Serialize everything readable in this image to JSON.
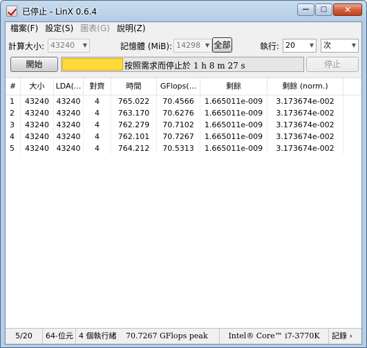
{
  "window": {
    "title": "已停止 - LinX 0.6.4",
    "minimize_glyph": "—",
    "maximize_glyph": "□",
    "close_glyph": "✕"
  },
  "menu": [
    {
      "label": "檔案(F)",
      "enabled": true
    },
    {
      "label": "設定(S)",
      "enabled": true
    },
    {
      "label": "圖表(G)",
      "enabled": false
    },
    {
      "label": "說明(Z)",
      "enabled": true
    }
  ],
  "controls": {
    "problem_size_label": "計算大小:",
    "problem_size_value": "43240",
    "memory_label": "記憶體 (MiB):",
    "memory_value": "14298",
    "all_button": "全部",
    "run_label": "執行:",
    "run_count": "20",
    "run_unit": "次",
    "start_button": "開始",
    "stop_button": "停止",
    "progress_text": "按照需求而停止於 1 h 8 m 27 s",
    "progress_fraction": 0.25
  },
  "table": {
    "columns": [
      "#",
      "大小",
      "LDA(...",
      "對齊",
      "時間",
      "GFlops(...",
      "剩餘",
      "剩餘 (norm.)"
    ],
    "rows": [
      [
        "1",
        "43240",
        "43240",
        "4",
        "765.022",
        "70.4566",
        "1.665011e-009",
        "3.173674e-002"
      ],
      [
        "2",
        "43240",
        "43240",
        "4",
        "763.170",
        "70.6276",
        "1.665011e-009",
        "3.173674e-002"
      ],
      [
        "3",
        "43240",
        "43240",
        "4",
        "762.279",
        "70.7102",
        "1.665011e-009",
        "3.173674e-002"
      ],
      [
        "4",
        "43240",
        "43240",
        "4",
        "762.101",
        "70.7267",
        "1.665011e-009",
        "3.173674e-002"
      ],
      [
        "5",
        "43240",
        "43240",
        "4",
        "764.212",
        "70.5313",
        "1.665011e-009",
        "3.173674e-002"
      ]
    ]
  },
  "status": {
    "progress": "5/20",
    "arch": "64-位元",
    "threads": "4 個執行緒",
    "peak": "70.7267 GFlops peak",
    "cpu": "Intel® Core™ i7-3770K",
    "log": "記錄 ›"
  }
}
